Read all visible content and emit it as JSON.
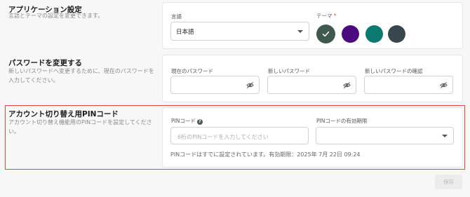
{
  "app_settings": {
    "title": "アプリケーション設定",
    "description": "言語とテーマの設定を変更できます。",
    "language_label": "言語",
    "language_value": "日本語",
    "theme_label": "テーマ",
    "theme_required_mark": "*",
    "theme_colors": [
      "#3f5a4d",
      "#4b0a7e",
      "#0b7a71",
      "#3a464d"
    ],
    "selected_theme_index": 0
  },
  "password": {
    "title": "パスワードを変更する",
    "description": "新しいパスワードへ変更するために、現在のパスワードを入力してください。",
    "current_label": "現在のパスワード",
    "new_label": "新しいパスワード",
    "confirm_label": "新しいパスワードの確認"
  },
  "pin": {
    "title": "アカウント切り替え用PINコード",
    "description": "アカウント切り替え機能用のPINコードを設定してください。",
    "pin_label": "PINコード",
    "pin_placeholder": "6桁のPINコードを入力してください",
    "expiry_label": "PINコードの有効期限",
    "status": "PINコードはすでに設定されています。有効期限：2025年 7月 22日 09:24"
  },
  "save_label": "保存"
}
